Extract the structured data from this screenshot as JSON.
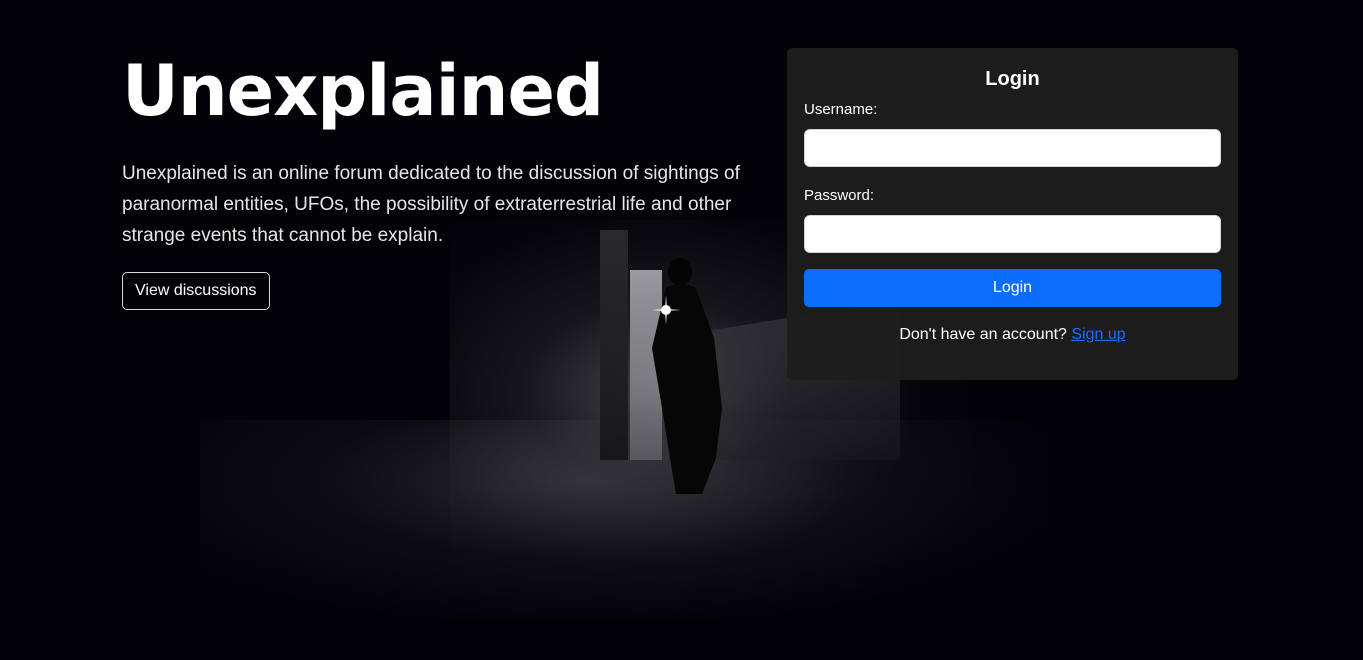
{
  "hero": {
    "title": "Unexplained",
    "description": "Unexplained is an online forum dedicated to the discussion of sightings of paranormal entities, UFOs, the possibility of extraterrestrial life and other strange events that cannot be explain.",
    "view_button_label": "View discussions"
  },
  "login": {
    "title": "Login",
    "username_label": "Username:",
    "username_value": "",
    "password_label": "Password:",
    "password_value": "",
    "submit_label": "Login",
    "signup_prompt": "Don't have an account?",
    "signup_link": "Sign up"
  },
  "colors": {
    "primary_button": "#0d6efd",
    "link": "#1a6dff",
    "card_background": "#1d1d1e",
    "page_background": "#030307"
  }
}
